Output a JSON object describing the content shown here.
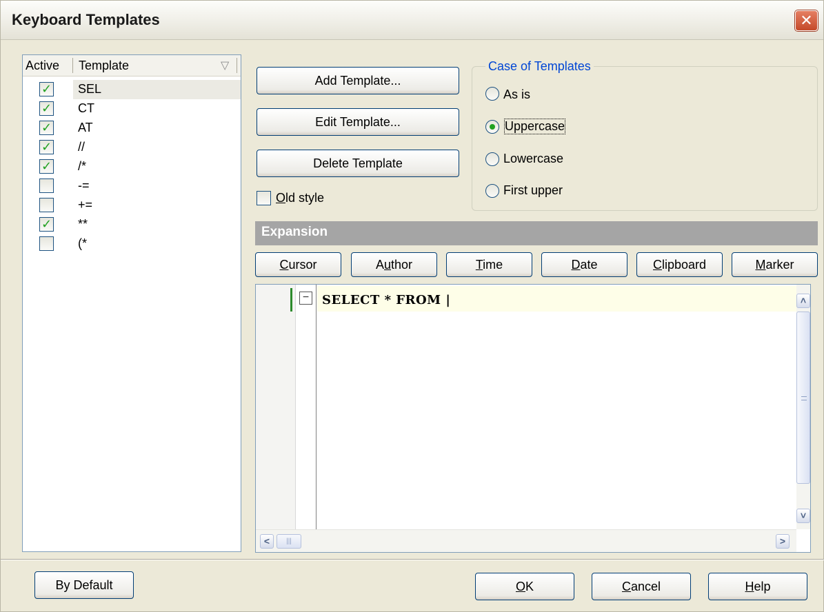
{
  "window": {
    "title": "Keyboard Templates",
    "close_glyph": "✕"
  },
  "list": {
    "headers": {
      "active": "Active",
      "template": "Template",
      "sort_glyph": "▽"
    },
    "rows": [
      {
        "label": "SEL",
        "checked": true,
        "selected": true
      },
      {
        "label": "CT",
        "checked": true
      },
      {
        "label": "AT",
        "checked": true
      },
      {
        "label": "//",
        "checked": true
      },
      {
        "label": "/*",
        "checked": true
      },
      {
        "label": "-=",
        "checked": false
      },
      {
        "label": "+=",
        "checked": false
      },
      {
        "label": "**",
        "checked": true
      },
      {
        "label": "(*",
        "checked": false
      }
    ]
  },
  "buttons": {
    "add": "Add Template...",
    "edit": "Edit Template...",
    "delete": "Delete Template"
  },
  "old_style": {
    "label_first": "O",
    "label_rest": "ld style",
    "checked": false
  },
  "case_group": {
    "title": "Case of Templates",
    "options": [
      "As is",
      "Uppercase",
      "Lowercase",
      "First upper"
    ],
    "selected": "Uppercase"
  },
  "expansion": {
    "title": "Expansion",
    "buttons": [
      {
        "pre": "",
        "key": "C",
        "post": "ursor"
      },
      {
        "pre": "A",
        "key": "u",
        "post": "thor"
      },
      {
        "pre": "",
        "key": "T",
        "post": "ime"
      },
      {
        "pre": "",
        "key": "D",
        "post": "ate"
      },
      {
        "pre": "",
        "key": "C",
        "post": "lipboard"
      },
      {
        "pre": "",
        "key": "M",
        "post": "arker"
      }
    ],
    "code": "SELECT * FROM |",
    "fold_glyph": "−"
  },
  "scrollbar": {
    "up": "˄",
    "down": "˅",
    "left": "<",
    "right": ">",
    "hgrip": "|||"
  },
  "footer": {
    "by_default": "By Default",
    "ok": {
      "key": "O",
      "rest": "K"
    },
    "cancel": {
      "key": "C",
      "rest": "ancel"
    },
    "help": {
      "key": "H",
      "rest": "elp"
    }
  },
  "colors": {
    "check": "#21a121",
    "group_title": "#0046d5",
    "expansion_bar": "#a5a5a5"
  }
}
